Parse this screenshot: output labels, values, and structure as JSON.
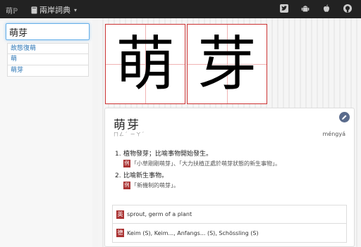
{
  "navbar": {
    "home_label": "萌ℙ",
    "dict_label": "兩岸詞典",
    "dict_caret": "▾",
    "icons": [
      "twitter-icon",
      "android-icon",
      "apple-icon",
      "github-icon"
    ]
  },
  "search": {
    "value": "萌芽"
  },
  "results": [
    "故態復萌",
    "萌",
    "萌芽"
  ],
  "strokes": [
    "萌",
    "芽"
  ],
  "entry": {
    "title": "萌芽",
    "bopomofo": "ㄇㄥˊ ㄧㄚˊ",
    "pinyin": "méngyá",
    "definitions": [
      {
        "num": "1.",
        "text": "植物發芽；比喻事物開始發生。",
        "example_badge": "例",
        "example": "「小草剛剛萌芽」、「大力扶植正處於萌芽狀態的新生事物」。"
      },
      {
        "num": "2.",
        "text": "比喻新生事物。",
        "example_badge": "例",
        "example": "「新機制的萌芽」。"
      }
    ],
    "translations": [
      {
        "badge": "英",
        "text": "sprout, germ of a plant"
      },
      {
        "badge": "德",
        "text": "Keim (S), Keim..., Anfangs... (S), Schössling (S)"
      }
    ]
  },
  "colors": {
    "accent_red": "#aa3333",
    "link": "#337ab7",
    "navbar": "#222222"
  }
}
